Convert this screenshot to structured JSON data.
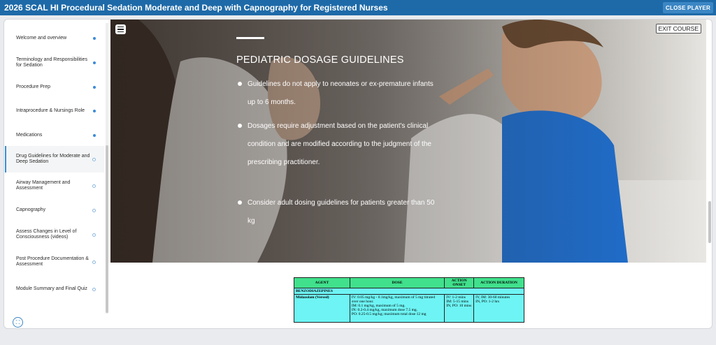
{
  "app": {
    "title": "2026 SCAL HI Procedural Sedation Moderate and Deep with Capnography for Registered Nurses",
    "close_label": "CLOSE PLAYER"
  },
  "sidebar": {
    "items": [
      {
        "label": "Welcome and overview",
        "state": "completed"
      },
      {
        "label": "Terminology and Responsibilities for Sedation",
        "state": "completed"
      },
      {
        "label": "Procedure Prep",
        "state": "completed"
      },
      {
        "label": "Intraprocedure & Nursings Role",
        "state": "completed"
      },
      {
        "label": "Medications",
        "state": "completed"
      },
      {
        "label": "Drug Guidelines for Moderate and Deep Sedation",
        "state": "active"
      },
      {
        "label": "Airway Management and Assessment",
        "state": "incomplete"
      },
      {
        "label": "Capnography",
        "state": "incomplete"
      },
      {
        "label": "Assess Changes in Level of Consciousness (videos)",
        "state": "incomplete"
      },
      {
        "label": "Post Procedure Documentation & Assessment",
        "state": "incomplete"
      },
      {
        "label": "Module Summary and Final Quiz",
        "state": "incomplete"
      }
    ]
  },
  "hero": {
    "exit_label": "EXIT COURSE",
    "title": "PEDIATRIC DOSAGE GUIDELINES",
    "bullets": [
      "Guidelines do not apply to neonates or ex-premature infants up to 6 months.",
      "Dosages require adjustment based on the patient's clinical condition and are modified according to the judgment of the prescribing practitioner.",
      "Consider adult dosing guidelines for patients greater than 50 kg"
    ]
  },
  "drug_table": {
    "headers": [
      "AGENT",
      "DOSE",
      "ACTION ONSET",
      "ACTION DURATION"
    ],
    "category": "BENZODIAZEPINES",
    "row": {
      "agent": "Midazolam (Versed)",
      "dose_lines": [
        "IV: 0.05 mg/kg - 0.1mg/kg, maximum of 5 mg titrated over one hour.",
        "IM: 0.1 mg/kg, maximum of 5 mg.",
        "IN: 0.2-0.4 mg/kg, maximum dose 7.5 mg.",
        "PO: 0.25-0.5 mg/kg; maximum total dose 12 mg"
      ],
      "onset_lines": [
        "IV: 1-2 mins",
        "IM: 5-15 mins",
        "IN, PO: 10 mins"
      ],
      "duration_lines": [
        "IV, IM: 30-60 minutes",
        "IN, PO: 1-2 hrs"
      ]
    }
  },
  "colors": {
    "topbar": "#1e6aa8",
    "accent": "#3a8fd6",
    "table_header": "#40e08c",
    "table_cell": "#6ef4f4"
  }
}
